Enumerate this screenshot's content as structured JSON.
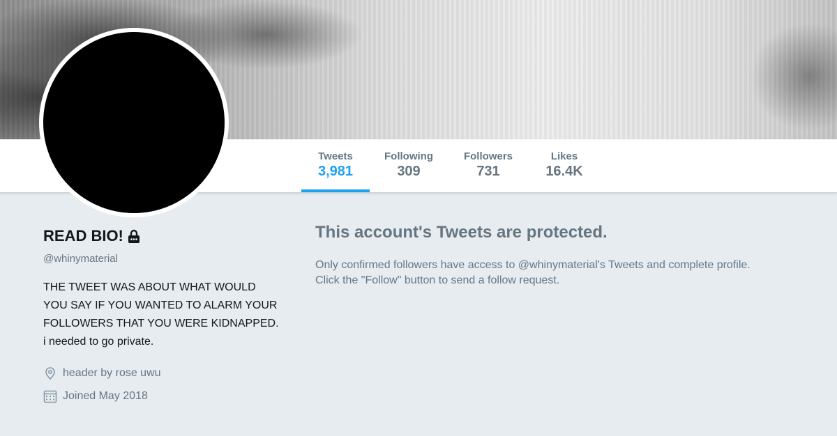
{
  "profile": {
    "name": "READ BIO!",
    "handle": "@whinymaterial",
    "bio": "THE TWEET WAS ABOUT WHAT WOULD YOU SAY IF YOU WANTED TO ALARM YOUR FOLLOWERS THAT YOU WERE KIDNAPPED. i needed to go private.",
    "location": "header by rose uwu",
    "joined": "Joined May 2018"
  },
  "stats": {
    "tweets": {
      "label": "Tweets",
      "value": "3,981"
    },
    "following": {
      "label": "Following",
      "value": "309"
    },
    "followers": {
      "label": "Followers",
      "value": "731"
    },
    "likes": {
      "label": "Likes",
      "value": "16.4K"
    }
  },
  "protected": {
    "title": "This account's Tweets are protected.",
    "line1": "Only confirmed followers have access to @whinymaterial's Tweets and complete profile.",
    "line2": "Click the \"Follow\" button to send a follow request."
  },
  "icons": {
    "lock": "lock-icon",
    "location": "location-pin-icon",
    "calendar": "calendar-icon"
  },
  "colors": {
    "accent": "#1da1f2",
    "page_background": "#e6ecf0",
    "avatar": "#000000"
  }
}
